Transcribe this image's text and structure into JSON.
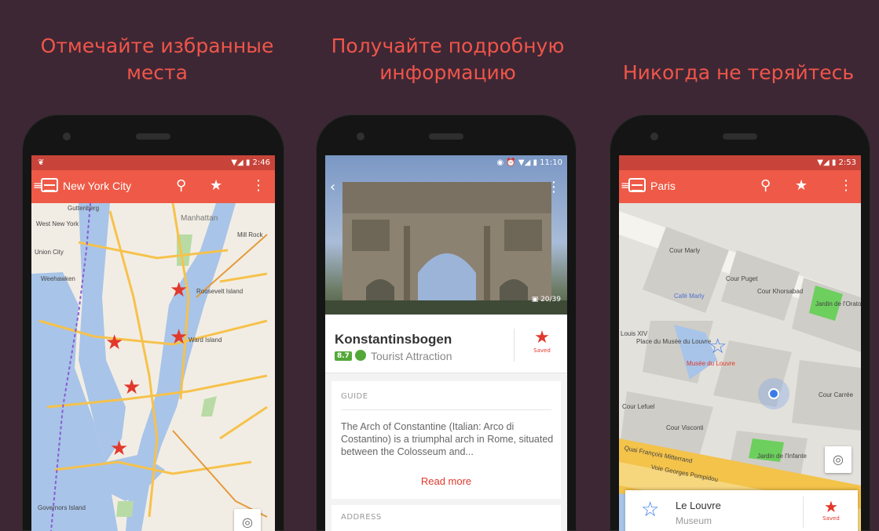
{
  "headings": {
    "left": "Отмечайте избранные\nместа",
    "middle": "Получайте подробную\nинформацию",
    "right": "Никогда не теряйтесь"
  },
  "phone1": {
    "status_time": "2:46",
    "title": "New York City",
    "map_labels": [
      "Guttenberg",
      "West New York",
      "Manhattan",
      "Mill Rock",
      "Union City",
      "Weehawken",
      "Roosevelt Island",
      "Ward Island",
      "Governors Island"
    ],
    "icons": {
      "menu": "hamburger-icon",
      "logo": "app-logo-icon",
      "search": "search-icon",
      "favorite": "star-icon",
      "overflow": "more-vert-icon",
      "locate": "my-location-icon"
    },
    "colors": {
      "toolbar": "#ee5a47",
      "star": "#e2382b",
      "water": "#a8c4e8"
    }
  },
  "phone2": {
    "status_time": "11:10",
    "photo_counter": "20/39",
    "place_name": "Konstantinsbogen",
    "rating": "8.7",
    "category": "Tourist Attraction",
    "saved_label": "Saved",
    "guide_heading": "GUIDE",
    "description": "The Arch of Constantine (Italian: Arco di Costantino) is a triumphal arch in Rome, situated between the Colosseum and...",
    "read_more": "Read more",
    "address_heading": "ADDRESS",
    "icons": {
      "back": "back-arrow-icon",
      "overflow": "more-vert-icon",
      "saved": "star-icon",
      "category": "attraction-icon"
    }
  },
  "phone3": {
    "status_time": "2:53",
    "title": "Paris",
    "map_labels": [
      "Cour Marly",
      "Cour Puget",
      "Café Marly",
      "Cour Khorsabad",
      "Jardin de l'Oratoire",
      "Louis XIV",
      "Place du Musée du Louvre",
      "Musée du Louvre",
      "Cour Lefuel",
      "Cour Visconti",
      "Jardin de l'Infante",
      "Cour Carrée",
      "Quai François Mitterrand",
      "Voie Georges Pompidou"
    ],
    "card_title": "Le Louvre",
    "card_subtitle": "Museum",
    "saved_label": "Saved",
    "icons": {
      "menu": "hamburger-icon",
      "search": "search-icon",
      "favorite": "star-icon",
      "overflow": "more-vert-icon",
      "locate": "my-location-icon",
      "place": "star-outline-icon"
    }
  }
}
